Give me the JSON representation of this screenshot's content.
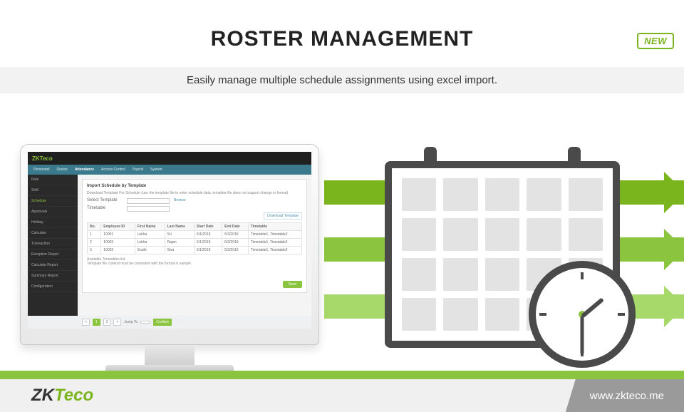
{
  "badge": "NEW",
  "title": "ROSTER MANAGEMENT",
  "subtitle": "Easily manage multiple schedule assignments using excel import.",
  "footer": {
    "brand_prefix": "ZK",
    "brand_suffix": "Teco",
    "url": "www.zkteco.me"
  },
  "screenshot": {
    "logo": "ZKTeco",
    "nav": [
      "Personnel",
      "Device",
      "Attendance",
      "Access Control",
      "Payroll",
      "System"
    ],
    "nav_active": "Attendance",
    "sidebar": [
      "Rule",
      "Shift",
      "Schedule",
      "Approvals",
      "Holiday",
      "Calculate",
      "Transaction",
      "Exception Report",
      "Calculate Report",
      "Summary Report",
      "Configuration"
    ],
    "card_title": "Import Schedule by Template",
    "hint": "Download Template For Schedule (use the template file to enter schedule data, template file does not support change in format)",
    "field1": "Select Template",
    "field2": "Timetable",
    "browse": "Browse",
    "download": "Download Template",
    "table": {
      "headers": [
        "No.",
        "Employee ID",
        "First Name",
        "Last Name",
        "Start Date",
        "End Date",
        "Timetable"
      ],
      "rows": [
        [
          "1",
          "10001",
          "Lekha",
          "Sri",
          "5/1/2019",
          "5/3/2019",
          "Timetable1, Timetable2"
        ],
        [
          "2",
          "10002",
          "Lekha",
          "Rajan",
          "5/1/2019",
          "5/3/2019",
          "Timetable1, Timetable2"
        ],
        [
          "3",
          "10003",
          "Sruthi",
          "Siva",
          "5/1/2019",
          "5/3/2019",
          "Timetable1, Timetable2"
        ]
      ],
      "note": "Available Timetables list\nTemplate file content must be consistent with the format in sample."
    },
    "save": "Save",
    "pager": {
      "prev": "<",
      "p1": "1",
      "p2": "2",
      "next": ">",
      "jump": "Jump To",
      "conf": "Confirm"
    }
  }
}
